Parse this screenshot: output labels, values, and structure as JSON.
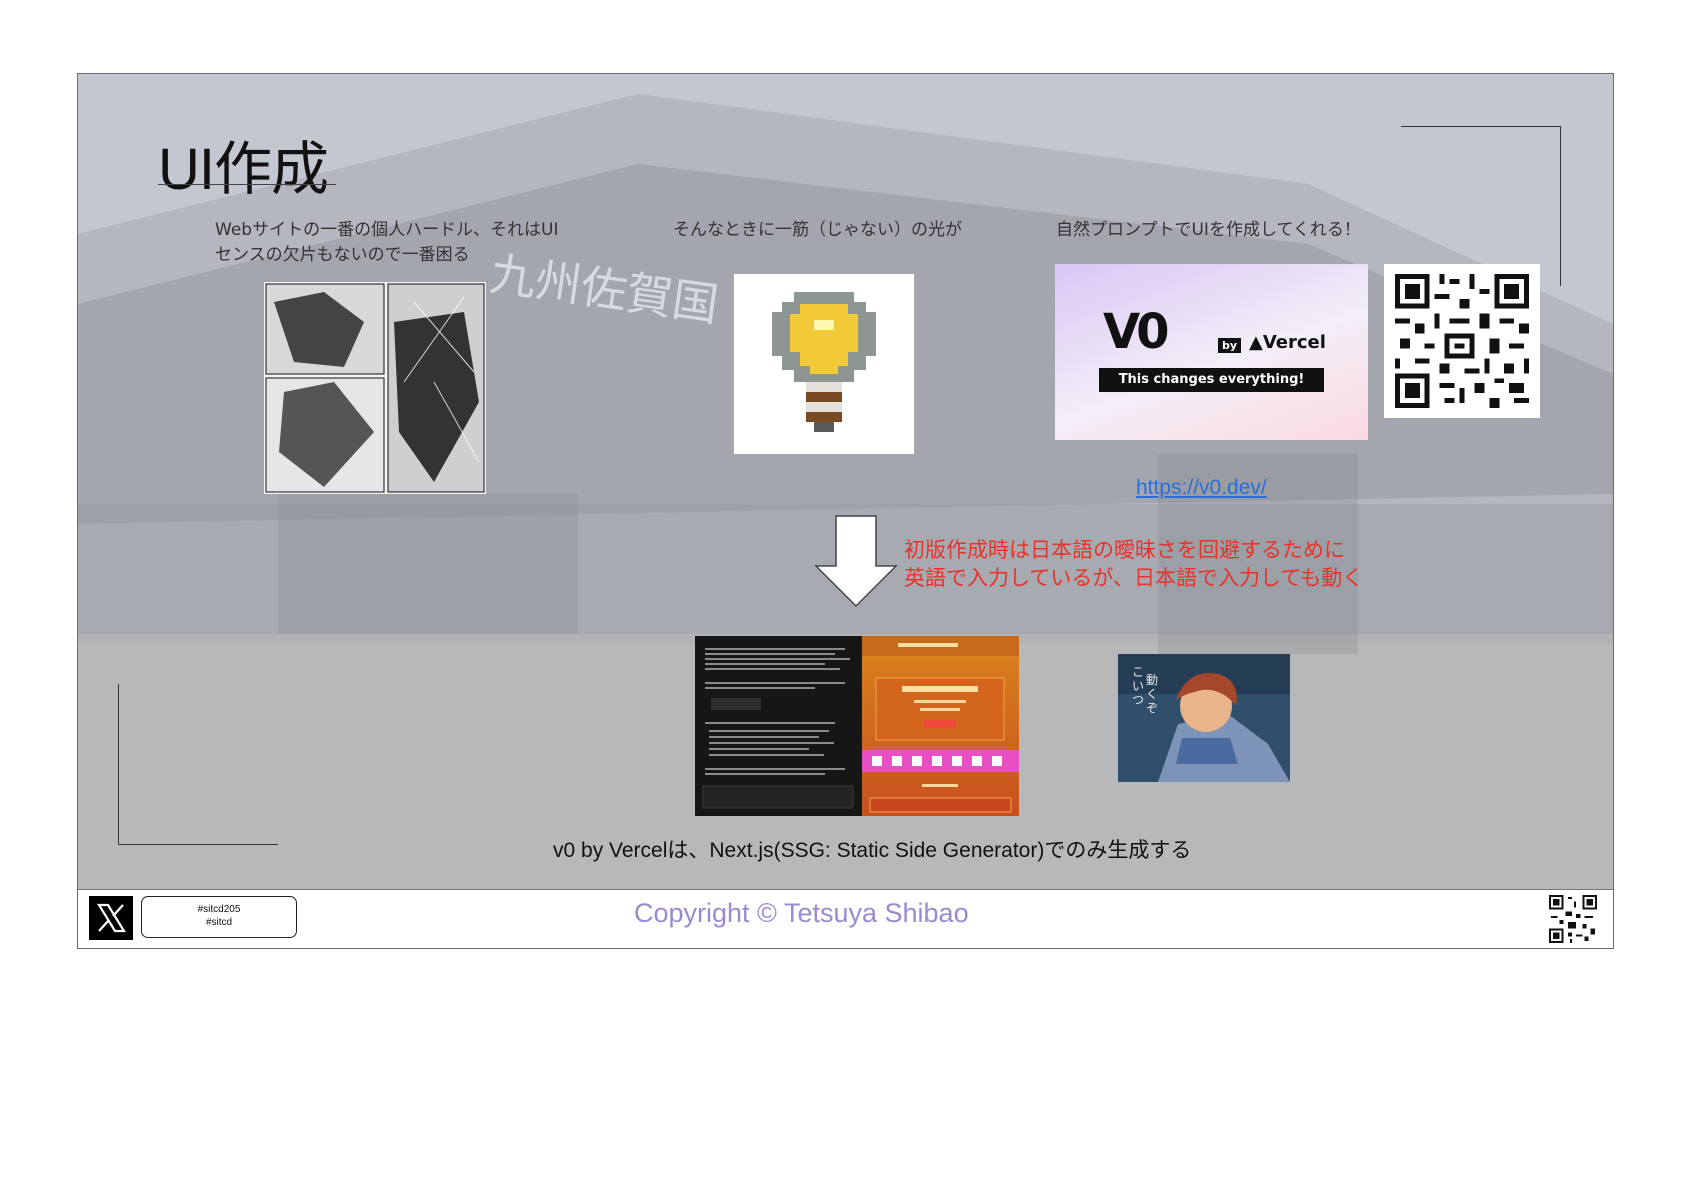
{
  "slide": {
    "title": "UI作成",
    "captions": {
      "left_line1": "Webサイトの一番の個人ハードル、それはUI",
      "left_line2": "センスの欠片もないので一番困る",
      "middle": "そんなときに一筋（じゃない）の光が",
      "right": "自然プロンプトでUIを作成してくれる！"
    },
    "v0_card": {
      "logo": "V0",
      "by": "by",
      "brand": "▲Vercel",
      "tagline": "This changes everything!"
    },
    "link": "https://v0.dev/",
    "red_note": {
      "line1": "初版作成時は日本語の曖昧さを回避するために",
      "line2": "英語で入力しているが、日本語で入力しても動く"
    },
    "bottom_caption": "v0 by Vercelは、Next.js(SSG: Static Side Generator)でのみ生成する",
    "colors": {
      "red_note": "#e8322a",
      "link": "#2a6fd8",
      "copyright": "#9b8ad0"
    }
  },
  "footer": {
    "hashtag1": "#sitcd205",
    "hashtag2": "#sitcd",
    "copyright": "Copyright © Tetsuya Shibao"
  }
}
